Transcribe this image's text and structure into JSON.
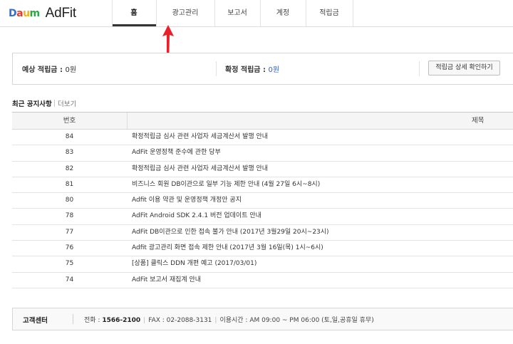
{
  "logo": {
    "daum": [
      "D",
      "a",
      "u",
      "m"
    ],
    "product": "AdFit"
  },
  "nav": {
    "tabs": [
      "홈",
      "광고관리",
      "보고서",
      "계정",
      "적립금"
    ],
    "active": 0
  },
  "earnings": {
    "expected_label": "예상 적립금 : ",
    "expected_value": "0원",
    "confirmed_label": "확정 적립금 : ",
    "confirmed_value": "0원",
    "detail_button": "적립금 상세 확인하기",
    "accent_color": "#2f62c9"
  },
  "notice": {
    "title": "최근 공지사항",
    "more": "더보기",
    "columns": [
      "번호",
      "제목"
    ],
    "rows": [
      {
        "no": "84",
        "title": "확정적립금 심사 관련 사업자 세금계산서 발행 안내"
      },
      {
        "no": "83",
        "title": "AdFit 운영정책 준수에 관한 당부"
      },
      {
        "no": "82",
        "title": "확정적립금 심사 관련 사업자 세금계산서 발행 안내"
      },
      {
        "no": "81",
        "title": "비즈니스 회원 DB이관으로 일부 기능 제한 안내 (4월 27일 6시~8시)"
      },
      {
        "no": "80",
        "title": "Adfit 이용 약관 및 운영정책 개정안 공지"
      },
      {
        "no": "78",
        "title": "AdFit Android SDK 2.4.1 버전 업데이트 안내"
      },
      {
        "no": "77",
        "title": "AdFit DB이관으로 인한 접속 불가 안내 (2017년 3월29일 20시~23시)"
      },
      {
        "no": "76",
        "title": "Adfit 광고관리 화면 접속 제한 안내 (2017년 3월 16일(목) 1시~6시)"
      },
      {
        "no": "75",
        "title": "[상품] 클릭스 DDN 개편 예고 (2017/03/01)"
      },
      {
        "no": "74",
        "title": "AdFit 보고서 재집계 안내"
      }
    ]
  },
  "footer": {
    "label": "고객센터",
    "phone_label": "전화 : ",
    "phone": "1566-2100",
    "fax": "FAX : 02-2088-3131",
    "hours": "이용시간 : AM 09:00 ~ PM 06:00 (토,일,공휴일 휴무)"
  }
}
